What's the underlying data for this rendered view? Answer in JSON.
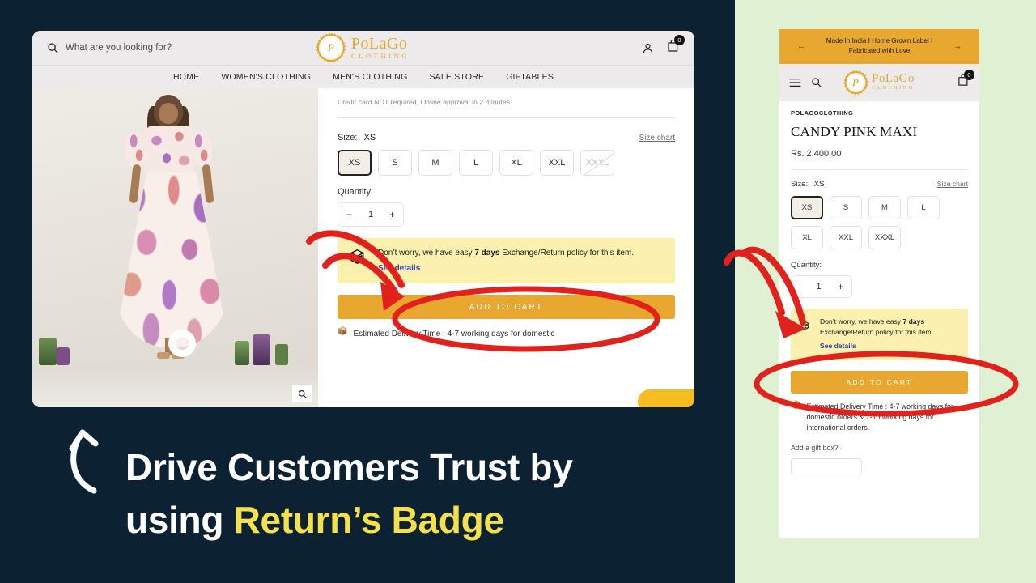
{
  "theme": {
    "background": "#0c2233",
    "panel_green": "#dff0d3",
    "brand_gold": "#e8a72e",
    "badge_yellow": "#fbf0ae",
    "link_blue": "#2f3fa8",
    "annotation_red": "#e0211c",
    "highlight_yellow": "#f4e04d"
  },
  "headline": {
    "line1": "Drive Customers Trust by",
    "line2_prefix": "using ",
    "line2_highlight": "Return’s Badge"
  },
  "desktop": {
    "search": {
      "placeholder": "What are you looking for?",
      "icon": "search-icon"
    },
    "logo": {
      "mark": "P",
      "main": "PoLaGo",
      "sub": "CLOTHING"
    },
    "icons": {
      "account": "account-icon",
      "cart": "cart-icon",
      "cart_count": "0"
    },
    "nav": [
      "HOME",
      "WOMEN'S CLOTHING",
      "MEN'S CLOTHING",
      "SALE STORE",
      "GIFTABLES"
    ],
    "gallery": {
      "zoom_icon": "magnify-icon"
    },
    "credit_note": "Credit card NOT required, Online approval in 2 minutes",
    "size": {
      "label": "Size:",
      "selected": "XS",
      "chart_link": "Size chart",
      "options": [
        {
          "label": "XS",
          "state": "selected"
        },
        {
          "label": "S",
          "state": "available"
        },
        {
          "label": "M",
          "state": "available"
        },
        {
          "label": "L",
          "state": "available"
        },
        {
          "label": "XL",
          "state": "available"
        },
        {
          "label": "XXL",
          "state": "available"
        },
        {
          "label": "XXXL",
          "state": "disabled"
        }
      ]
    },
    "quantity": {
      "label": "Quantity:",
      "value": "1",
      "minus": "−",
      "plus": "+"
    },
    "return_badge": {
      "icon": "return-parcel-icon",
      "text_before": "Don’t worry, we have easy ",
      "text_bold": "7 days",
      "text_after": " Exchange/Return policy for this item.",
      "link": "See details"
    },
    "add_to_cart": "ADD TO CART",
    "delivery": {
      "emoji": "📦",
      "text": "Estimated Delivery Time : 4-7 working days for domestic"
    }
  },
  "mobile": {
    "announcement": {
      "text": "Made In India I Home Grown Label I Fabricated with Love",
      "prev": "←",
      "next": "→"
    },
    "header": {
      "menu_icon": "hamburger-icon",
      "search_icon": "search-icon",
      "cart_icon": "cart-icon",
      "cart_count": "0"
    },
    "logo": {
      "mark": "P",
      "main": "PoLaGo",
      "sub": "CLOTHING"
    },
    "vendor": "POLAGOCLOTHING",
    "product_title": "CANDY PINK MAXI",
    "price": "Rs. 2,400.00",
    "size": {
      "label": "Size:",
      "selected": "XS",
      "chart_link": "Size chart",
      "options": [
        {
          "label": "XS",
          "state": "selected"
        },
        {
          "label": "S",
          "state": "available"
        },
        {
          "label": "M",
          "state": "available"
        },
        {
          "label": "L",
          "state": "available"
        },
        {
          "label": "XL",
          "state": "available"
        },
        {
          "label": "XXL",
          "state": "available"
        },
        {
          "label": "XXXL",
          "state": "available"
        }
      ]
    },
    "quantity": {
      "label": "Quantity:",
      "value": "1",
      "plus": "+"
    },
    "return_badge": {
      "icon": "return-parcel-icon",
      "text_before": "Don’t worry, we have easy ",
      "text_bold": "7 days",
      "text_after": " Exchange/Return policy for this item.",
      "link": "See details"
    },
    "add_to_cart": "ADD TO CART",
    "delivery": {
      "emoji": "📦",
      "text": "Estimated Delivery Time : 4-7 working days for domestic orders & 7-10 working days for international orders."
    },
    "gift_box_label": "Add a gift box?"
  }
}
